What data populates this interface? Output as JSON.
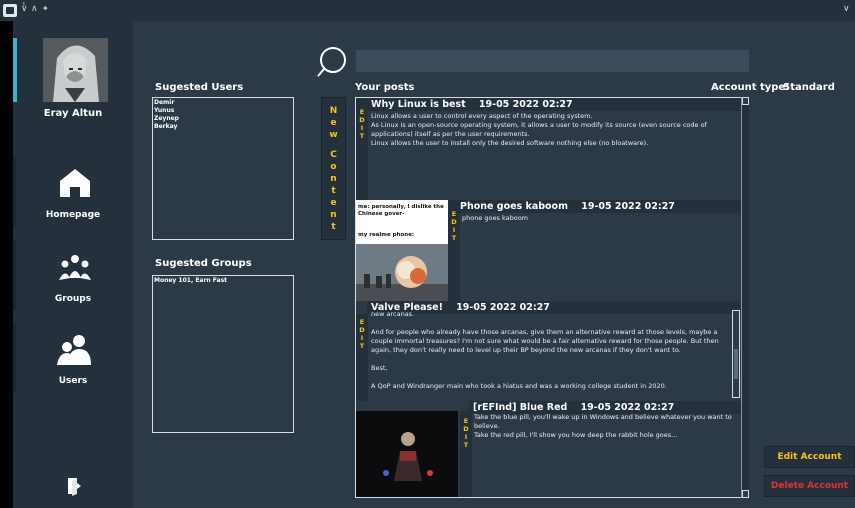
{
  "titlebar": {
    "icons": [
      "app-icon",
      "chevron-down-double-icon",
      "chevron-up-double-icon",
      "pin-icon",
      "chevron-down-icon"
    ]
  },
  "user": {
    "name": "Eray Altun"
  },
  "nav": [
    {
      "label": "Homepage",
      "icon": "home-icon"
    },
    {
      "label": "Groups",
      "icon": "groups-icon"
    },
    {
      "label": "Users",
      "icon": "users-icon"
    },
    {
      "label": "",
      "icon": "logout-icon"
    }
  ],
  "search": {
    "value": "",
    "placeholder": ""
  },
  "suggested_users": {
    "title": "Sugested Users",
    "items": [
      "Demir",
      "Yunus",
      "Zeynep",
      "Berkay"
    ]
  },
  "suggested_groups": {
    "title": "Sugested Groups",
    "items": [
      "Money 101, Earn Fast"
    ]
  },
  "new_content": {
    "letters": [
      "N",
      "e",
      "w",
      "",
      "C",
      "o",
      "n",
      "t",
      "e",
      "n",
      "t"
    ]
  },
  "posts_header": {
    "title": "Your posts",
    "account_type_label": "Account type:",
    "account_type_value": "Standard"
  },
  "edit_letters": [
    "E",
    "D",
    "I",
    "T"
  ],
  "posts": [
    {
      "title": "Why Linux is best",
      "date": "19-05 2022 02:27",
      "body": "Linux allows a user to control every aspect of the operating system.\nAs Linux is an open-source operating system, it allows a user to modify its source (even source code of applications) itself as per the user requirements.\nLinux allows the user to install only the desired software nothing else (no bloatware)."
    },
    {
      "title": "Phone goes kaboom",
      "date": "19-05 2022 02:27",
      "body": "phone goes kaboom",
      "image_caption_1": "me: personally, I dislike the Chinese gover-",
      "image_caption_2": "my realme phone:"
    },
    {
      "title": "Valve Please!",
      "date": "19-05 2022 02:27",
      "body": "new arcanas.\n\nAnd for people who already have those arcanas, give them an alternative reward at those levels, maybe a couple immortal treasures? I'm not sure what would be a fair alternative reward for those people. But then again, they don't really need to level up their BP beyond the new arcanas if they don't want to.\n\nBest,\n\nA QoP and Windranger main who took a hiatus and was a working college student in 2020."
    },
    {
      "title": "[rEFInd] Blue Red",
      "date": "19-05 2022 02:27",
      "body": "Take the blue pill, you'll wake up in Windows and believe whatever you want to believe.\nTake the red pill, I'll show you how deep the rabbit hole goes..."
    }
  ],
  "buttons": {
    "edit_account": "Edit Account",
    "delete_account": "Delete Account"
  },
  "colors": {
    "accent": "#3db0d8",
    "edit_yellow": "#f5c518",
    "delete_red": "#e0303a",
    "background": "#2c3a48",
    "sidebar": "#24303c"
  }
}
